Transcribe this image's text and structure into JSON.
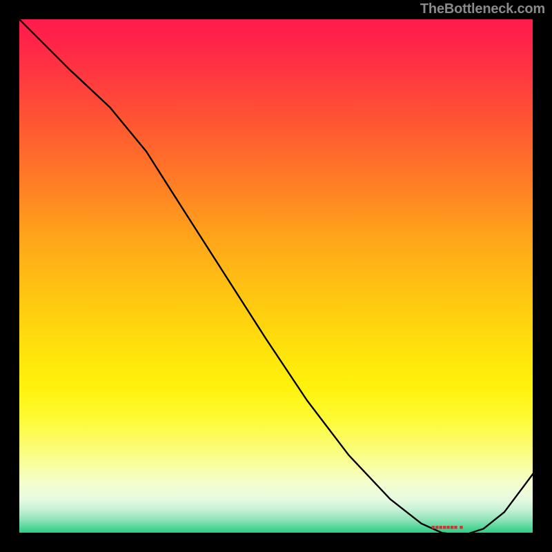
{
  "watermark": "TheBottleneck.com",
  "chart_data": {
    "type": "line",
    "title": "",
    "xlabel": "",
    "ylabel": "",
    "xlim": [
      0,
      100
    ],
    "ylim": [
      0,
      100
    ],
    "grid": false,
    "series": [
      {
        "name": "curve",
        "x": [
          0,
          4,
          10,
          18,
          25,
          32,
          40,
          48,
          56,
          64,
          72,
          78,
          82,
          86,
          90,
          94,
          100
        ],
        "values": [
          100,
          96,
          90,
          82.5,
          74,
          63,
          50.5,
          38,
          26,
          15.5,
          7,
          2.3,
          0.5,
          0,
          1.3,
          4.5,
          12.5
        ]
      }
    ],
    "annotations": [
      {
        "text": "■■■■■■■ ■",
        "x": 83,
        "y": 1.2
      }
    ],
    "background": {
      "gradient_direction": "vertical",
      "stops": [
        {
          "pos": 0.0,
          "color": "#ff1a4d"
        },
        {
          "pos": 0.5,
          "color": "#ffbb14"
        },
        {
          "pos": 0.8,
          "color": "#fbfd74"
        },
        {
          "pos": 0.95,
          "color": "#c7f1d6"
        },
        {
          "pos": 1.0,
          "color": "#1bc97a"
        }
      ]
    }
  }
}
